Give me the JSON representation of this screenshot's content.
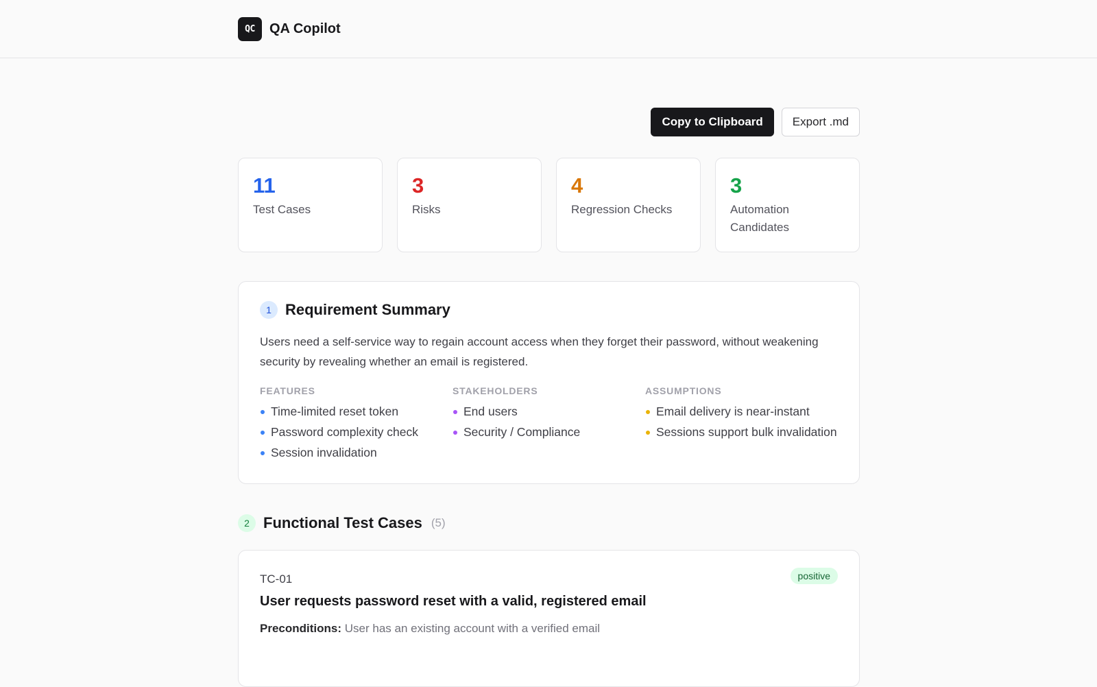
{
  "app": {
    "logo_text": "QC",
    "name": "QA Copilot"
  },
  "actions": {
    "copy_label": "Copy to Clipboard",
    "export_label": "Export .md"
  },
  "stats": [
    {
      "value": "11",
      "label": "Test Cases",
      "color": "#2563eb"
    },
    {
      "value": "3",
      "label": "Risks",
      "color": "#dc2626"
    },
    {
      "value": "4",
      "label": "Regression Checks",
      "color": "#d97706"
    },
    {
      "value": "3",
      "label": "Automation Candidates",
      "color": "#16a34a"
    }
  ],
  "summary": {
    "number": "1",
    "title": "Requirement Summary",
    "text": "Users need a self-service way to regain account access when they forget their password, without weakening security by revealing whether an email is registered.",
    "features": {
      "heading": "Features",
      "color": "#3b82f6",
      "items": [
        "Time-limited reset token",
        "Password complexity check",
        "Session invalidation"
      ]
    },
    "stakeholders": {
      "heading": "Stakeholders",
      "color": "#a855f7",
      "items": [
        "End users",
        "Security / Compliance"
      ]
    },
    "assumptions": {
      "heading": "Assumptions",
      "color": "#eab308",
      "items": [
        "Email delivery is near-instant",
        "Sessions support bulk invalidation"
      ]
    }
  },
  "functional": {
    "number": "2",
    "title": "Functional Test Cases",
    "count": "(5)",
    "cases": [
      {
        "id": "TC-01",
        "badge": "positive",
        "title": "User requests password reset with a valid, registered email",
        "preconditions_label": "Preconditions:",
        "preconditions": "User has an existing account with a verified email"
      }
    ]
  }
}
